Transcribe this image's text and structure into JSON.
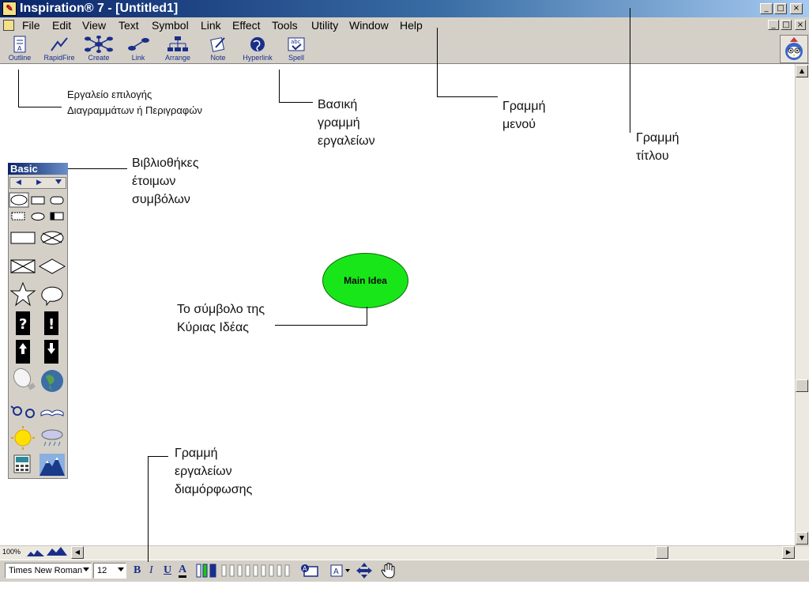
{
  "window": {
    "title": "Inspiration® 7 - [Untitled1]",
    "minimize": "_",
    "maximize": "□",
    "close": "×"
  },
  "menu": [
    "File",
    "Edit",
    "View",
    "Text",
    "Symbol",
    "Link",
    "Effect",
    "Tools",
    "Utility",
    "Window",
    "Help"
  ],
  "toolbar": [
    {
      "label": "Outline",
      "icon": "outline-icon"
    },
    {
      "label": "RapidFire",
      "icon": "rapidfire-icon"
    },
    {
      "label": "Create",
      "icon": "create-icon"
    },
    {
      "label": "Link",
      "icon": "link-icon"
    },
    {
      "label": "Arrange",
      "icon": "arrange-icon"
    },
    {
      "label": "Note",
      "icon": "note-icon"
    },
    {
      "label": "Hyperlink",
      "icon": "hyperlink-icon"
    },
    {
      "label": "Spell",
      "icon": "spell-icon"
    }
  ],
  "palette": {
    "title": "Basic"
  },
  "main_idea": {
    "label": "Main Idea",
    "color": "#19e619"
  },
  "annotations": {
    "outline_tool": [
      "Εργαλείο επιλογής",
      "Διαγραμμάτων ή Περιγραφών"
    ],
    "basic_toolbar": [
      "Βασική",
      "γραμμή",
      "εργαλείων"
    ],
    "menu_bar": [
      "Γραμμή",
      "μενού"
    ],
    "title_bar": [
      "Γραμμή",
      "τίτλου"
    ],
    "symbol_libraries": [
      "Βιβλιοθήκες",
      "έτοιμων",
      "συμβόλων"
    ],
    "main_idea_symbol": [
      "Το σύμβολο της",
      "Κύριας Ιδέας"
    ],
    "format_toolbar": [
      "Γραμμή",
      "εργαλείων",
      "διαμόρφωσης"
    ]
  },
  "zoom": "100%",
  "format": {
    "font": "Times New Roman",
    "size": "12",
    "bold": "B",
    "italic": "I",
    "underline": "U",
    "color": "A"
  }
}
